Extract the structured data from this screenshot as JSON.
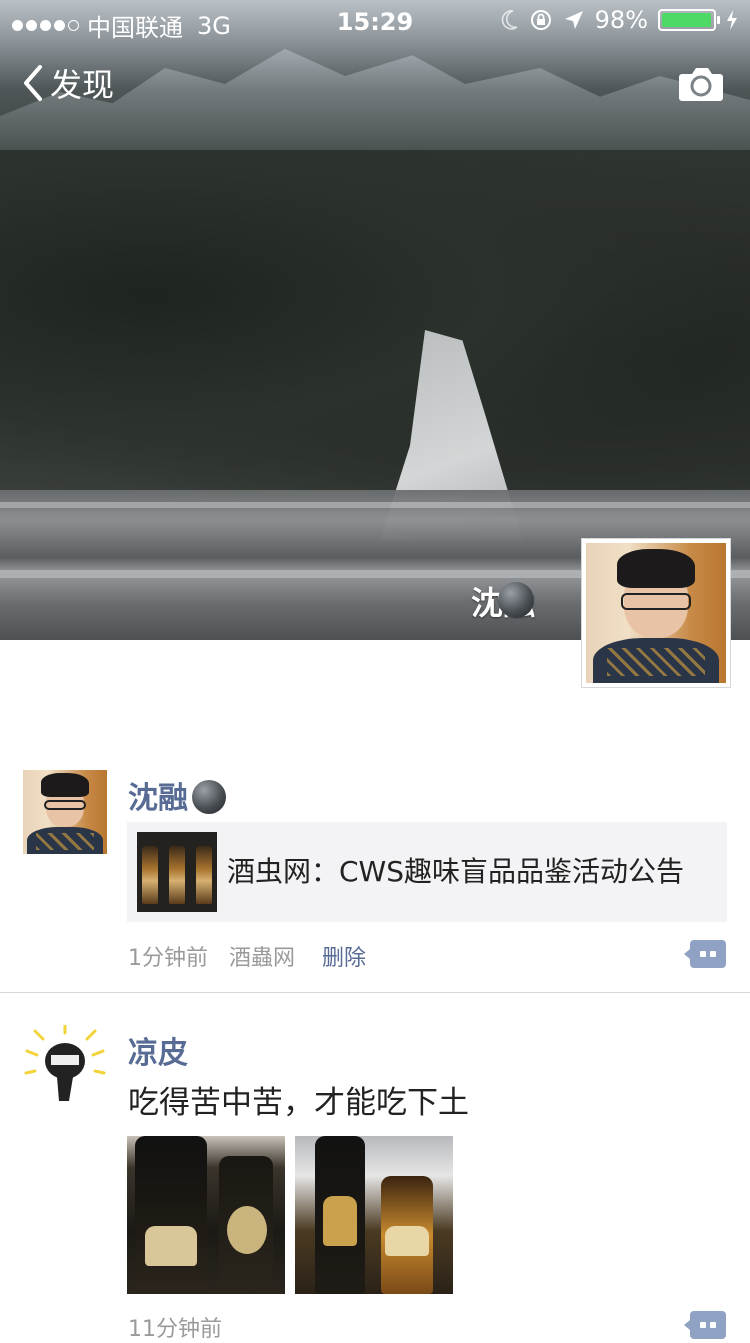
{
  "status_bar": {
    "carrier": "中国联通",
    "network": "3G",
    "time": "15:29",
    "battery": "98%",
    "battery_level": 0.98
  },
  "nav": {
    "back_label": "发现",
    "back_icon": "chevron-left-icon",
    "camera_icon": "camera-icon"
  },
  "profile": {
    "name": "沈融"
  },
  "posts": [
    {
      "author": "沈融",
      "link_title": "酒虫网：CWS趣味盲品品鉴活动公告",
      "time": "1分钟前",
      "source": "酒蟲网",
      "delete_label": "删除"
    },
    {
      "author": "凉皮",
      "text": "吃得苦中苦，才能吃下土",
      "time": "11分钟前"
    }
  ],
  "colors": {
    "name_link": "#576b95",
    "battery_fill": "#4cd964",
    "meta_text": "#9a9a9a"
  }
}
